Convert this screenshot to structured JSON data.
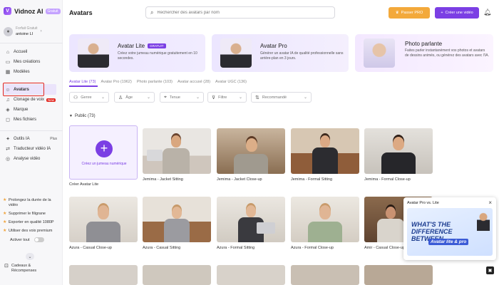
{
  "brand": {
    "name": "Vidnoz AI",
    "plan": "Gratuit",
    "accent": "#7b3fe4"
  },
  "user": {
    "plan": "Forfait Gratuit",
    "name": "antoine LI"
  },
  "sidebar": {
    "items": [
      {
        "label": "Accueil",
        "icon": "home-icon"
      },
      {
        "label": "Mes créations",
        "icon": "folder-icon"
      },
      {
        "label": "Modèles",
        "icon": "template-icon"
      },
      {
        "label": "Avatars",
        "icon": "avatar-icon",
        "active": true
      },
      {
        "label": "Clonage de voix",
        "icon": "voice-icon",
        "badge": "New"
      },
      {
        "label": "Marque",
        "icon": "brand-icon"
      },
      {
        "label": "Mes fichiers",
        "icon": "files-icon"
      }
    ],
    "tools": [
      {
        "label": "Outils IA",
        "icon": "tools-icon",
        "tag": "Plus"
      },
      {
        "label": "Traducteur vidéo IA",
        "icon": "translate-icon"
      },
      {
        "label": "Analyse vidéo",
        "icon": "analyze-icon"
      }
    ],
    "upsell": [
      "Prolongez la durée de la vidéo",
      "Supprimer le filigrane",
      "Exporter en qualité 1080P",
      "Utiliser des voix premium"
    ],
    "activate_all": "Activer tout",
    "rewards": "Cadeaux & Récompenses"
  },
  "header": {
    "title": "Avatars",
    "search_placeholder": "Rechercher des avatars par nom",
    "upgrade_label": "Passer PRO",
    "create_label": "Créer une vidéo"
  },
  "promos": [
    {
      "title": "Avatar Lite",
      "badge": "GRATUIT",
      "desc": "Créez votre jumeau numérique gratuitement en 10 secondes."
    },
    {
      "title": "Avatar Pro",
      "desc": "Générer un avatar IA de qualité professionnelle sans arrière-plan en 3 jours."
    },
    {
      "title": "Photo parlante",
      "desc": "Faites parler instantanément vos photos et avatars de dessins animés, ou générez des avatars avec l'IA."
    }
  ],
  "tabs": [
    "Avatar Lite (73)",
    "Avatar Pro (1962)",
    "Photo parlante (103)",
    "Avatar accusé (28)",
    "Avatar UGC (136)"
  ],
  "filters": [
    "Genre",
    "Âge",
    "Tenue",
    "Filtre",
    "Recommandé"
  ],
  "section": "Public (73)",
  "create_card": {
    "label": "Créez un jumeau numérique",
    "caption": "Créer Avatar Lite"
  },
  "avatars_row1": [
    {
      "caption": "Jemima - Jacket Sitting"
    },
    {
      "caption": "Jemima - Jacket Close-up"
    },
    {
      "caption": "Jemima - Formal Sitting"
    },
    {
      "caption": "Jemima - Formal Close-up"
    }
  ],
  "avatars_row2": [
    {
      "caption": "Azura - Casual Close-up"
    },
    {
      "caption": "Azura - Casual Sitting"
    },
    {
      "caption": "Azura - Formal Sitting"
    },
    {
      "caption": "Azura - Formal Close-up"
    },
    {
      "caption": "Amir - Casual Close-up"
    }
  ],
  "popup": {
    "title": "Avatar Pro vs. Lite",
    "headline": "WHAT'S THE DIFFERENCE BETWEEN",
    "sub": "Avatar lite & pro"
  }
}
